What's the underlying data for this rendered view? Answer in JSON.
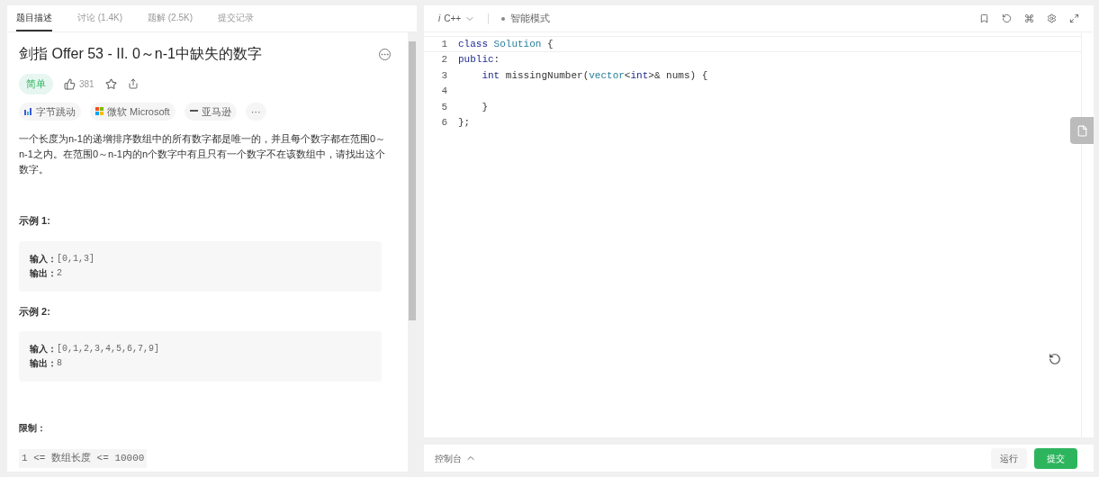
{
  "tabs": [
    {
      "label": "题目描述",
      "selected": true
    },
    {
      "label": "讨论 (1.4K)",
      "selected": false
    },
    {
      "label": "题解 (2.5K)",
      "selected": false
    },
    {
      "label": "提交记录",
      "selected": false
    }
  ],
  "problem": {
    "title": "剑指 Offer 53 - II. 0～n-1中缺失的数字",
    "difficulty": "简单",
    "likes": "381",
    "companies": [
      {
        "name": "字节跳动",
        "kind": "bytedance"
      },
      {
        "name": "微软 Microsoft",
        "kind": "microsoft"
      },
      {
        "name": "亚马逊",
        "kind": "amazon"
      },
      {
        "name": "···",
        "kind": "more"
      }
    ],
    "description": "一个长度为n-1的递增排序数组中的所有数字都是唯一的，并且每个数字都在范围0～n-1之内。在范围0～n-1内的n个数字中有且只有一个数字不在该数组中，请找出这个数字。",
    "examples": [
      {
        "heading": "示例 1:",
        "input_label": "输入：",
        "input": "[0,1,3]",
        "output_label": "输出：",
        "output": "2"
      },
      {
        "heading": "示例 2:",
        "input_label": "输入：",
        "input": "[0,1,2,3,4,5,6,7,9]",
        "output_label": "输出：",
        "output": "8"
      }
    ],
    "limits_heading": "限制：",
    "limit": "1 <= 数组长度 <= 10000"
  },
  "editor": {
    "language_icon": "i",
    "language": "C++",
    "mode": "智能模式",
    "lines": [
      {
        "number": "1",
        "tokens": [
          {
            "text": "class",
            "kind": "keyword"
          },
          {
            "text": " Solution",
            "kind": "type"
          },
          {
            "text": " {",
            "kind": "plain"
          }
        ]
      },
      {
        "number": "2",
        "tokens": [
          {
            "text": "public",
            "kind": "keyword"
          },
          {
            "text": ":",
            "kind": "plain"
          }
        ]
      },
      {
        "number": "3",
        "tokens": [
          {
            "text": "    int",
            "kind": "keyword"
          },
          {
            "text": " missingNumber(",
            "kind": "plain"
          },
          {
            "text": "vector",
            "kind": "type"
          },
          {
            "text": "<",
            "kind": "plain"
          },
          {
            "text": "int",
            "kind": "keyword"
          },
          {
            "text": ">& nums) {",
            "kind": "plain"
          }
        ]
      },
      {
        "number": "4"
      },
      {
        "number": "5",
        "tokens": [
          {
            "text": "    }",
            "kind": "plain"
          }
        ]
      },
      {
        "number": "6",
        "tokens": [
          {
            "text": "};",
            "kind": "plain"
          }
        ]
      }
    ]
  },
  "footer": {
    "console": "控制台",
    "run": "运行",
    "submit": "提交"
  }
}
